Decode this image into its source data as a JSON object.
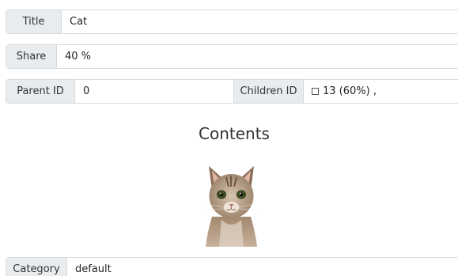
{
  "fields": {
    "title": {
      "label": "Title",
      "value": "Cat"
    },
    "share": {
      "label": "Share",
      "value": "40 %"
    },
    "parent_id": {
      "label": "Parent ID",
      "value": "0"
    },
    "children_id": {
      "label": "Children ID",
      "value": "13 (60%) ,"
    },
    "category": {
      "label": "Category",
      "value": "default"
    }
  },
  "contents": {
    "heading": "Contents",
    "image_icon": "cat-photo"
  }
}
